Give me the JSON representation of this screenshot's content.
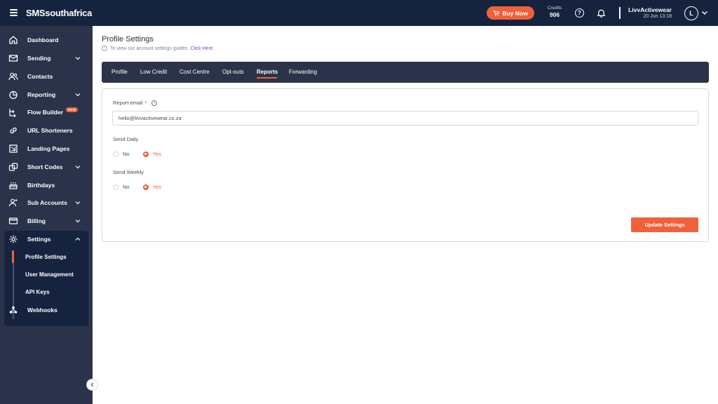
{
  "topbar": {
    "brand": "SMSsouthafrica",
    "buy_now_label": "Buy Now",
    "credits_label": "Credits",
    "credits_value": "906",
    "user_name": "LivvActivewear",
    "datetime": "20 Jun 13:18",
    "avatar_initial": "L"
  },
  "sidebar": {
    "items": [
      {
        "label": "Dashboard",
        "icon": "home-icon"
      },
      {
        "label": "Sending",
        "icon": "envelope-icon"
      },
      {
        "label": "Contacts",
        "icon": "users-icon"
      },
      {
        "label": "Reporting",
        "icon": "pie-chart-icon"
      },
      {
        "label": "Flow Builder",
        "icon": "flow-icon",
        "badge": "NEW"
      },
      {
        "label": "URL Shorteners",
        "icon": "link-icon"
      },
      {
        "label": "Landing Pages",
        "icon": "landing-page-icon"
      },
      {
        "label": "Short Codes",
        "icon": "short-codes-icon"
      },
      {
        "label": "Birthdays",
        "icon": "cake-icon"
      },
      {
        "label": "Sub Accounts",
        "icon": "user-plus-icon"
      },
      {
        "label": "Billing",
        "icon": "credit-card-icon"
      },
      {
        "label": "Settings",
        "icon": "gear-icon"
      },
      {
        "label": "Webhooks",
        "icon": "webhook-icon"
      }
    ],
    "settings_sub": [
      "Profile Settings",
      "User Management",
      "API Keys"
    ]
  },
  "main": {
    "title": "Profile Settings",
    "guide_text": "To view our account settings guides",
    "guide_link": "Click Here.",
    "tabs": [
      "Profile",
      "Low Credit",
      "Cost Centre",
      "Opt-outs",
      "Reports",
      "Forwarding"
    ],
    "active_tab": "Reports",
    "form": {
      "report_email_label": "Report email",
      "required_mark": "*",
      "report_email_value": "hello@livvactivewear.co.za",
      "send_daily_label": "Send Daily",
      "send_weekly_label": "Send Weekly",
      "no_label": "No",
      "yes_label": "Yes",
      "send_daily_value": "Yes",
      "send_weekly_value": "Yes",
      "update_button": "Update Settings"
    }
  },
  "colors": {
    "accent": "#f0603a",
    "topbar": "#15233f",
    "sidebar": "#2a3349",
    "link": "#7b3fe4"
  }
}
